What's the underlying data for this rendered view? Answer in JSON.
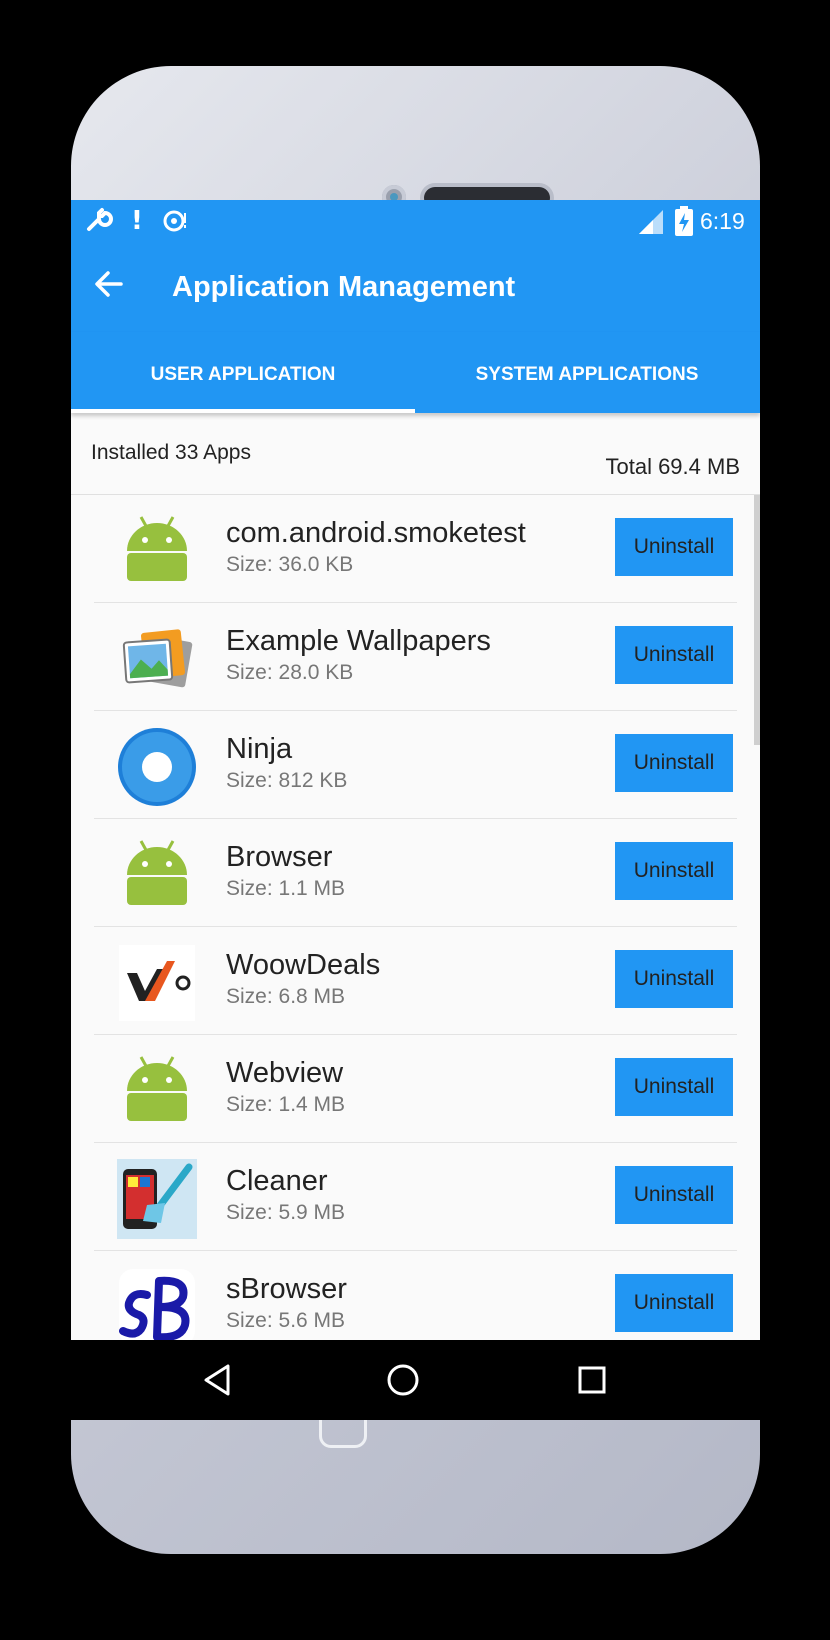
{
  "status_bar": {
    "time": "6:19",
    "left_icons": [
      "wrench-icon",
      "alert-icon",
      "sync-warning-icon"
    ],
    "right_icons": [
      "signal-icon",
      "battery-charging-icon"
    ]
  },
  "app_bar": {
    "title": "Application Management",
    "back_icon": "arrow-back-icon"
  },
  "tabs": [
    {
      "label": "USER APPLICATION",
      "active": true
    },
    {
      "label": "SYSTEM APPLICATIONS",
      "active": false
    }
  ],
  "summary": {
    "installed": "Installed 33 Apps",
    "total": "Total 69.4 MB"
  },
  "apps": [
    {
      "name": "com.android.smoketest",
      "size": "Size: 36.0 KB",
      "icon": "android-robot-icon",
      "action": "Uninstall"
    },
    {
      "name": "Example Wallpapers",
      "size": "Size: 28.0 KB",
      "icon": "wallpapers-gallery-icon",
      "action": "Uninstall"
    },
    {
      "name": "Ninja",
      "size": "Size: 812 KB",
      "icon": "ninja-ring-icon",
      "action": "Uninstall"
    },
    {
      "name": "Browser",
      "size": "Size: 1.1 MB",
      "icon": "android-robot-icon",
      "action": "Uninstall"
    },
    {
      "name": "WoowDeals",
      "size": "Size: 6.8 MB",
      "icon": "woowdeals-logo-icon",
      "action": "Uninstall"
    },
    {
      "name": "Webview",
      "size": "Size: 1.4 MB",
      "icon": "android-robot-icon",
      "action": "Uninstall"
    },
    {
      "name": "Cleaner",
      "size": "Size: 5.9 MB",
      "icon": "cleaner-phone-brush-icon",
      "action": "Uninstall"
    },
    {
      "name": "sBrowser",
      "size": "Size: 5.6 MB",
      "icon": "sbrowser-logo-icon",
      "action": "Uninstall"
    }
  ],
  "nav_bar": [
    "back-triangle-icon",
    "home-circle-icon",
    "recents-square-icon"
  ],
  "colors": {
    "primary": "#2196f3",
    "android_green": "#97c03e"
  }
}
